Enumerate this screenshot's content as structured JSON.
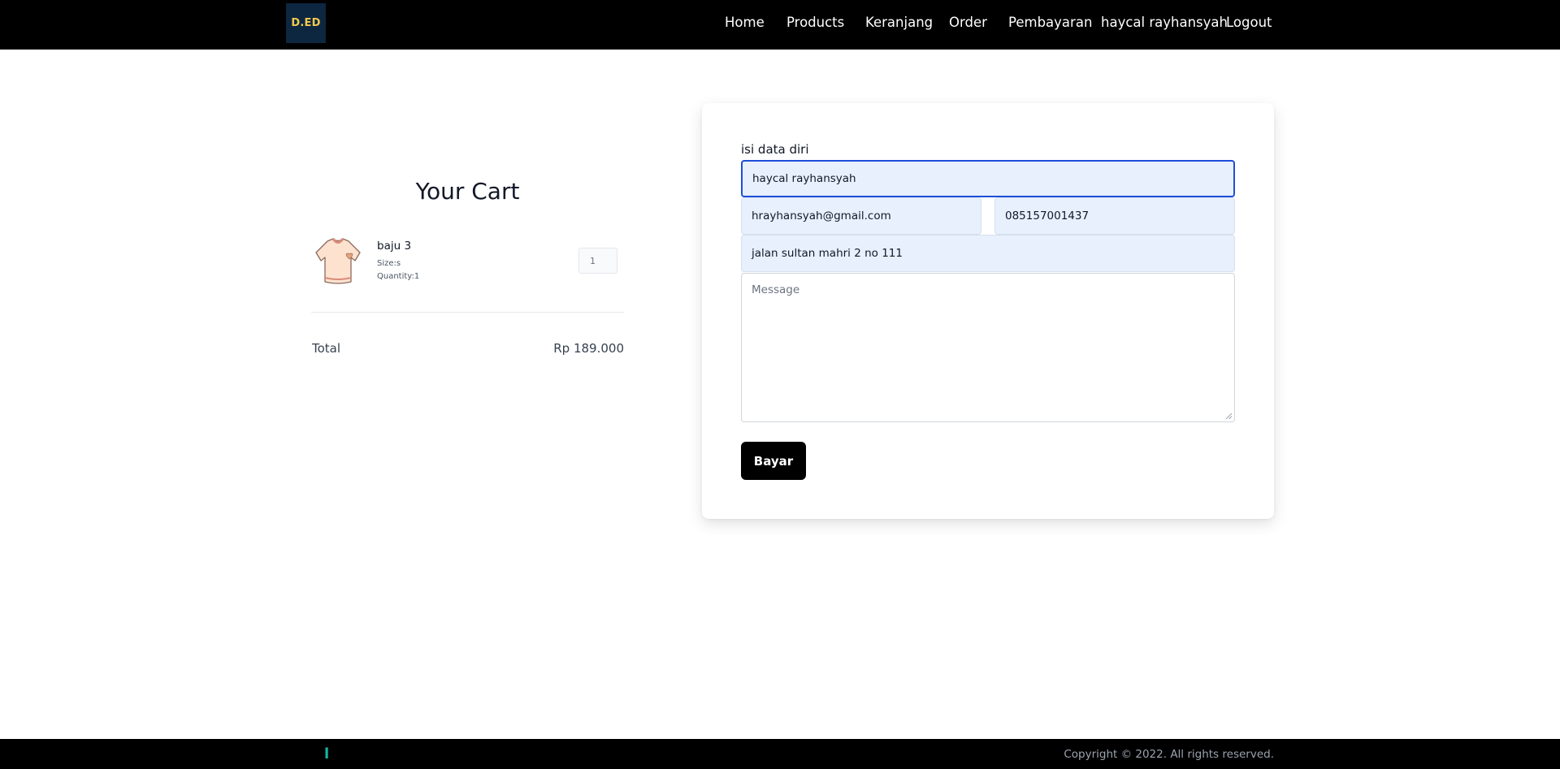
{
  "header": {
    "logo_text": "D.ED",
    "nav": [
      {
        "label": "Home"
      },
      {
        "label": "Products"
      },
      {
        "label": "Keranjang"
      },
      {
        "label": "Order"
      },
      {
        "label": "Pembayaran"
      },
      {
        "label": "haycal rayhansyah"
      },
      {
        "label": "Logout"
      }
    ]
  },
  "cart": {
    "title": "Your Cart",
    "items": [
      {
        "name": "baju 3",
        "size": "Size:s",
        "quantity": "Quantity:1",
        "qty_value": "1",
        "image_icon": "tshirt-icon"
      }
    ],
    "total_label": "Total",
    "total_value": "Rp 189.000"
  },
  "form": {
    "title": "isi data diri",
    "name": "haycal rayhansyah",
    "email": "hrayhansyah@gmail.com",
    "phone": "085157001437",
    "address": "jalan sultan mahri 2 no 111",
    "message_placeholder": "Message",
    "submit_label": "Bayar"
  },
  "footer": {
    "mark": "l",
    "copyright": "Copyright © 2022. All rights reserved."
  },
  "colors": {
    "nav_bg": "#000000",
    "field_bg": "#e8f0fe",
    "focus_border": "#1d4ed8",
    "logo_bg": "#0d2740",
    "logo_text": "#f2c94c",
    "footer_mark": "#14b8a6"
  }
}
